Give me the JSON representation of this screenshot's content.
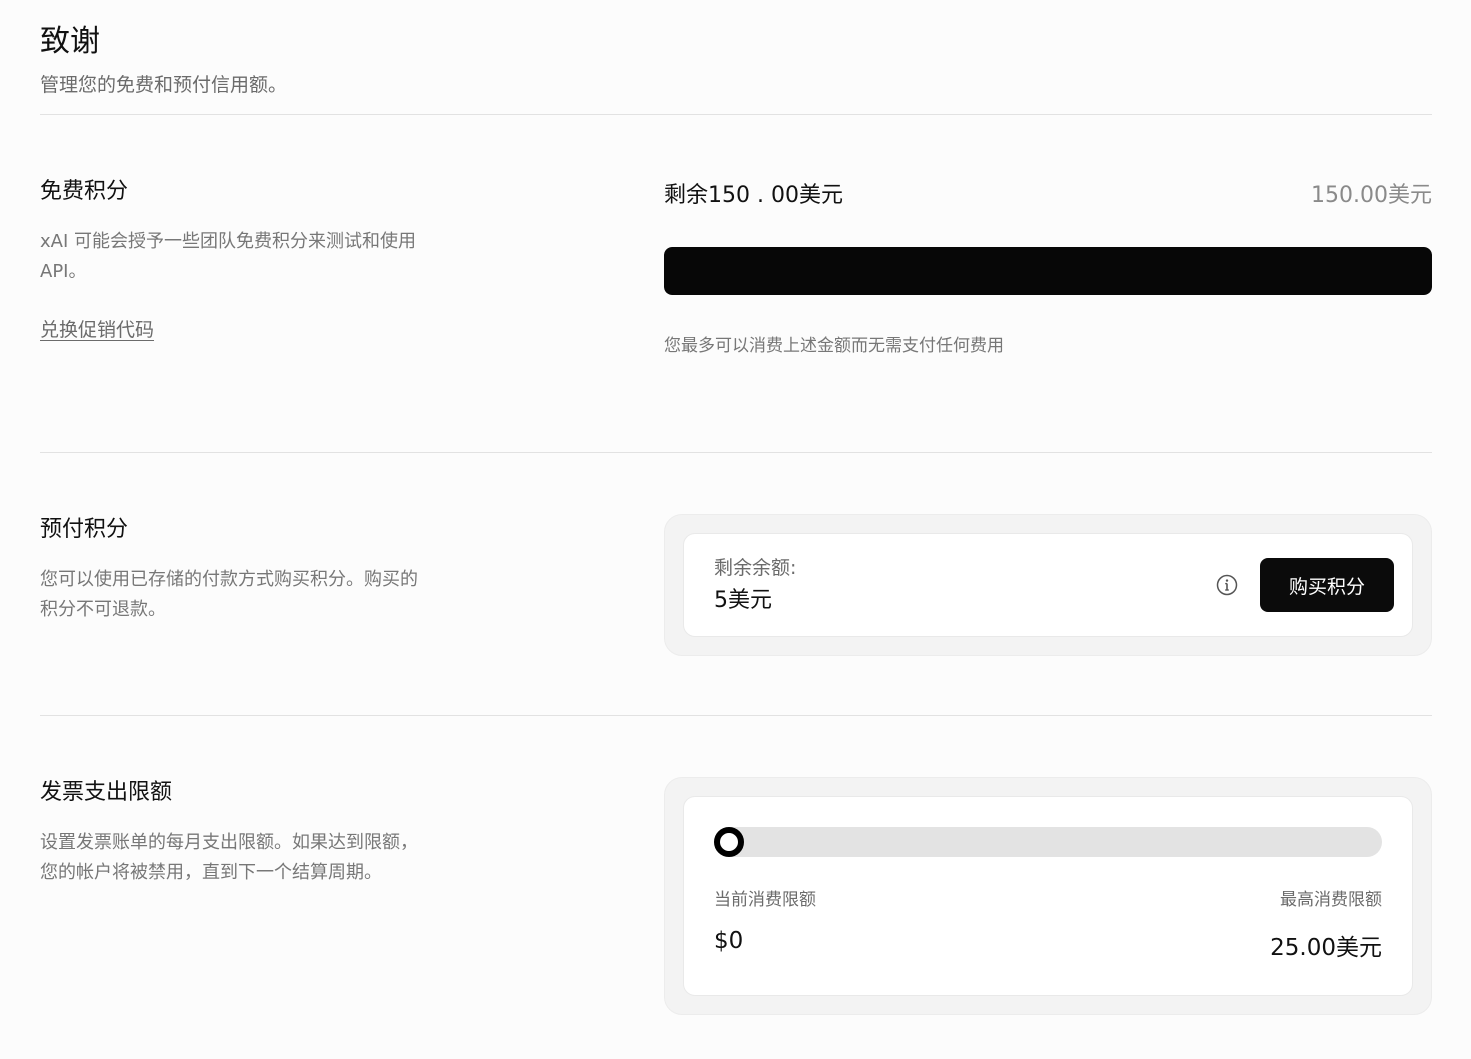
{
  "header": {
    "title": "致谢",
    "subtitle": "管理您的免费和预付信用额。"
  },
  "free_credits": {
    "title": "免费积分",
    "description": "xAI 可能会授予一些团队免费积分来测试和使用 API。",
    "promo_link": "兑换促销代码",
    "remaining_label": "剩余150 . 00美元",
    "total": "150.00美元",
    "remaining_fraction": 1.0,
    "note": "您最多可以消费上述金额而无需支付任何费用"
  },
  "prepaid_credits": {
    "title": "预付积分",
    "description": "您可以使用已存储的付款方式购买积分。购买的积分不可退款。",
    "balance_label": "剩余余额:",
    "balance_value": "5美元",
    "buy_button": "购买积分",
    "info_icon": "info-circle-icon"
  },
  "spending_limit": {
    "title": "发票支出限额",
    "description": "设置发票账单的每月支出限额。如果达到限额，您的帐户将被禁用，直到下一个结算周期。",
    "current_label": "当前消费限额",
    "max_label": "最高消费限额",
    "current_value": "$0",
    "max_value": "25.00美元",
    "slider_fraction": 0.0
  },
  "colors": {
    "background": "#fcfcfc",
    "accent": "#070707",
    "muted_text": "#777777",
    "track": "#e3e3e3"
  }
}
